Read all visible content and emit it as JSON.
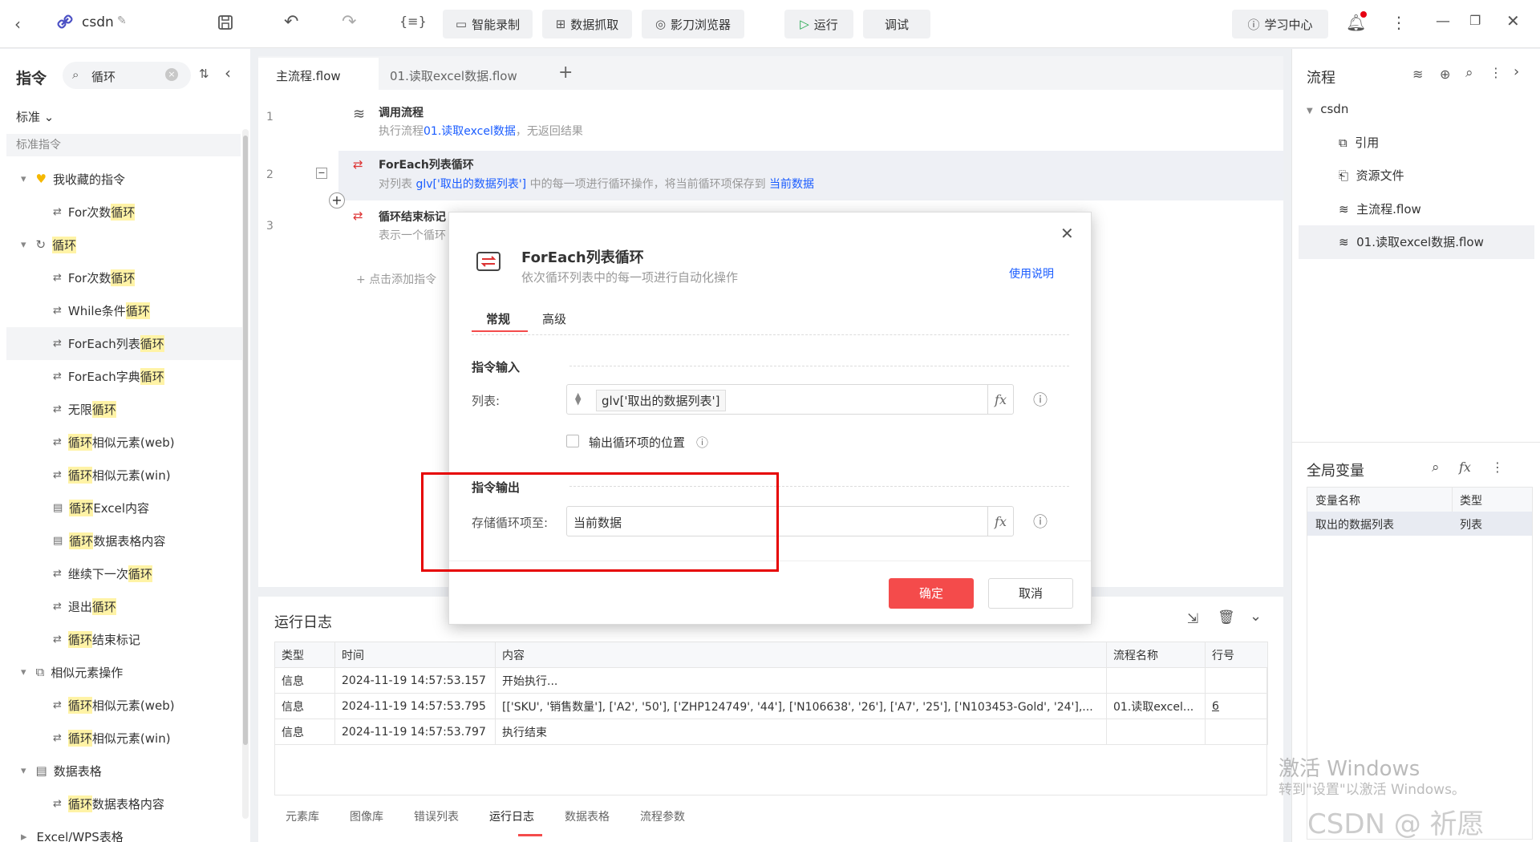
{
  "toolbar": {
    "project_name": "csdn",
    "smart_record": "智能录制",
    "data_grab": "数据抓取",
    "browser": "影刀浏览器",
    "run": "运行",
    "debug": "调试",
    "learn": "学习中心"
  },
  "left": {
    "title": "指令",
    "search_value": "循环",
    "filter": "标准",
    "section": "标准指令",
    "groups": [
      {
        "label": "我收藏的指令",
        "items": [
          {
            "pre": "For次数",
            "hl": "循环",
            "post": ""
          }
        ]
      },
      {
        "label": "循环",
        "items": [
          {
            "pre": "For次数",
            "hl": "循环",
            "post": ""
          },
          {
            "pre": "While条件",
            "hl": "循环",
            "post": ""
          },
          {
            "pre": "ForEach列表",
            "hl": "循环",
            "post": ""
          },
          {
            "pre": "ForEach字典",
            "hl": "循环",
            "post": ""
          },
          {
            "pre": "无限",
            "hl": "循环",
            "post": ""
          },
          {
            "pre": "",
            "hl": "循环",
            "post": "相似元素(web)"
          },
          {
            "pre": "",
            "hl": "循环",
            "post": "相似元素(win)"
          },
          {
            "pre": "",
            "hl": "循环",
            "post": "Excel内容"
          },
          {
            "pre": "",
            "hl": "循环",
            "post": "数据表格内容"
          },
          {
            "pre": "继续下一次",
            "hl": "循环",
            "post": ""
          },
          {
            "pre": "退出",
            "hl": "循环",
            "post": ""
          },
          {
            "pre": "",
            "hl": "循环",
            "post": "结束标记"
          }
        ]
      },
      {
        "label": "相似元素操作",
        "items": [
          {
            "pre": "",
            "hl": "循环",
            "post": "相似元素(web)"
          },
          {
            "pre": "",
            "hl": "循环",
            "post": "相似元素(win)"
          }
        ]
      },
      {
        "label": "数据表格",
        "items": [
          {
            "pre": "",
            "hl": "循环",
            "post": "数据表格内容"
          }
        ]
      }
    ],
    "partial_last": "Excel/WPS表格"
  },
  "tabs": [
    "主流程.flow",
    "01.读取excel数据.flow"
  ],
  "flow": [
    {
      "num": "1",
      "title": "调用流程",
      "desc_pre": "执行流程",
      "desc_link": "01.读取excel数据",
      "desc_post": "，无返回结果"
    },
    {
      "num": "2",
      "title": "ForEach列表循环",
      "desc_pre": "对列表 ",
      "desc_link": "glv['取出的数据列表']",
      "desc_mid": " 中的每一项进行循环操作，将当前循环项保存到 ",
      "desc_link2": "当前数据"
    },
    {
      "num": "3",
      "title": "循环结束标记",
      "desc_pre": "表示一个循环"
    }
  ],
  "add_cmd": "点击添加指令",
  "dialog": {
    "title": "ForEach列表循环",
    "subtitle": "依次循环列表中的每一项进行自动化操作",
    "help": "使用说明",
    "tab_general": "常规",
    "tab_advanced": "高级",
    "input_section": "指令输入",
    "list_label": "列表:",
    "list_value": "glv['取出的数据列表']",
    "checkbox_label": "输出循环项的位置",
    "output_section": "指令输出",
    "store_label": "存储循环项至:",
    "store_value": "当前数据",
    "ok": "确定",
    "cancel": "取消",
    "fx": "fx"
  },
  "log": {
    "title": "运行日志",
    "headers": [
      "类型",
      "时间",
      "内容",
      "流程名称",
      "行号"
    ],
    "rows": [
      [
        "信息",
        "2024-11-19 14:57:53.157",
        "开始执行...",
        "",
        ""
      ],
      [
        "信息",
        "2024-11-19 14:57:53.795",
        "[['SKU', '销售数量'], ['A2', '50'], ['ZHP124749', '44'], ['N106638', '26'], ['A7', '25'], ['N103453-Gold', '24'],...",
        "01.读取excel...",
        "6"
      ],
      [
        "信息",
        "2024-11-19 14:57:53.797",
        "执行结束",
        "",
        ""
      ]
    ],
    "bottom_tabs": [
      "元素库",
      "图像库",
      "错误列表",
      "运行日志",
      "数据表格",
      "流程参数"
    ]
  },
  "right": {
    "title": "流程",
    "root": "csdn",
    "items": [
      "引用",
      "资源文件",
      "主流程.flow",
      "01.读取excel数据.flow"
    ],
    "vars_title": "全局变量",
    "var_headers": [
      "变量名称",
      "类型"
    ],
    "var_rows": [
      [
        "取出的数据列表",
        "列表"
      ]
    ]
  },
  "watermark": {
    "line1": "激活 Windows",
    "line2": "转到\"设置\"以激活 Windows。",
    "csdn": "CSDN @ 祈愿"
  },
  "colors": {
    "accent": "#1a5cff",
    "danger": "#f44b4b",
    "highlight": "#fff3a6",
    "red_box": "#e60000"
  }
}
